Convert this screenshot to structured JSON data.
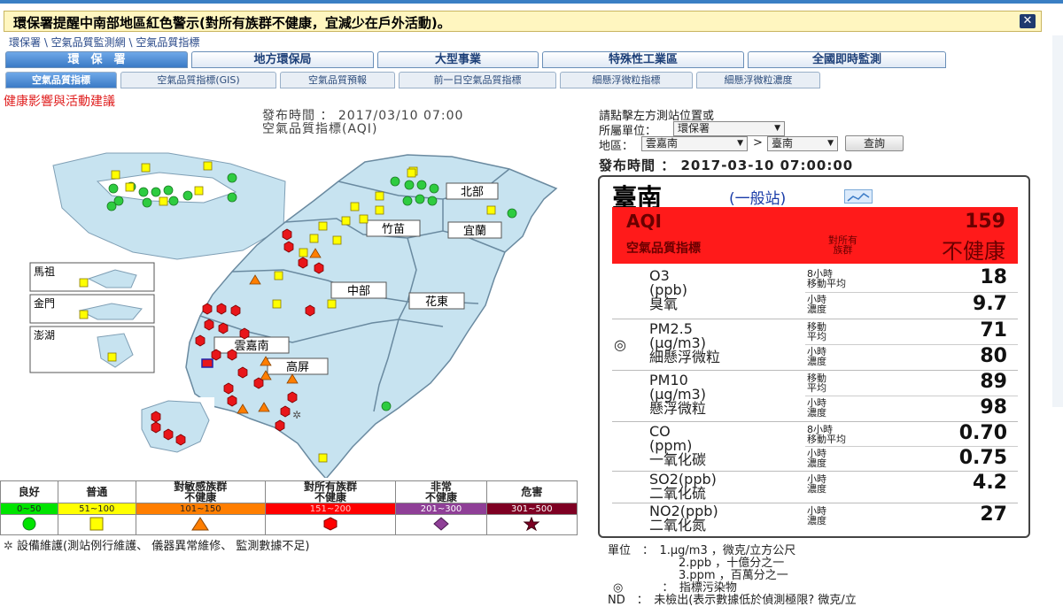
{
  "warning": {
    "text": "環保署提醒中南部地區紅色警示(對所有族群不健康，宜減少在戶外活動)。",
    "close_icon": "close-icon"
  },
  "breadcrumb": "環保署 \\ 空氣品質監測網 \\ 空氣品質指標",
  "main_tabs": [
    "環　保　署",
    "地方環保局",
    "大型事業",
    "特殊性工業區",
    "全國即時監測"
  ],
  "sub_tabs": [
    "空氣品質指標",
    "空氣品質指標(GIS)",
    "空氣品質預報",
    "前一日空氣品質指標",
    "細懸浮微粒指標",
    "細懸浮微粒濃度"
  ],
  "health_link": "健康影響與活動建議",
  "map": {
    "publish_time": "發布時間 ： 2017/03/10 07:00",
    "title": "空氣品質指標(AQI)",
    "regions": [
      "北部",
      "竹苗",
      "宜蘭",
      "中部",
      "花東",
      "雲嘉南",
      "高屏"
    ],
    "islands": [
      "馬祖",
      "金門",
      "澎湖"
    ]
  },
  "legend": {
    "headers": [
      "良好",
      "普通",
      "對敏感族群\n不健康",
      "對所有族群\n不健康",
      "非常\n不健康",
      "危害"
    ],
    "ranges": [
      "0~50",
      "51~100",
      "101~150",
      "151~200",
      "201~300",
      "301~500"
    ],
    "colors": [
      "#00e400",
      "#ffff00",
      "#ff7e00",
      "#ff0000",
      "#8f3f97",
      "#7e0023"
    ],
    "symbols": [
      "circle",
      "square",
      "triangle",
      "hexagon",
      "diamond",
      "star"
    ],
    "maintenance": "設備維護(測站例行維護、 儀器異常維修、 監測數據不足)"
  },
  "query": {
    "hint": "請點擊左方測站位置或",
    "unit_label": "所屬單位：",
    "unit_value": "環保署",
    "area_label": "地區：",
    "area_value": "雲嘉南",
    "city_value": "臺南",
    "search_button": "查詢"
  },
  "station": {
    "publish_time": "發布時間 ： 2017-03-10 07:00:00",
    "name": "臺南",
    "type": "(一般站)",
    "aqi_label": "AQI",
    "aqi_value": "159",
    "aqi_sub": "空氣品質指標",
    "group": "對所有\n族群",
    "status": "不健康",
    "pollutants": [
      {
        "name": "O3",
        "unit": "(ppb)",
        "cn": "臭氧",
        "primary": false,
        "m1_label": "8小時\n移動平均",
        "m1_value": "18",
        "m2_label": "小時\n濃度",
        "m2_value": "9.7"
      },
      {
        "name": "PM2.5",
        "unit": "(μg/m3)",
        "cn": "細懸浮微粒",
        "primary": true,
        "m1_label": "移動\n平均",
        "m1_value": "71",
        "m2_label": "小時\n濃度",
        "m2_value": "80"
      },
      {
        "name": "PM10",
        "unit": "(μg/m3)",
        "cn": "懸浮微粒",
        "primary": false,
        "m1_label": "移動\n平均",
        "m1_value": "89",
        "m2_label": "小時\n濃度",
        "m2_value": "98"
      },
      {
        "name": "CO",
        "unit": "(ppm)",
        "cn": "一氧化碳",
        "primary": false,
        "m1_label": "8小時\n移動平均",
        "m1_value": "0.70",
        "m2_label": "小時\n濃度",
        "m2_value": "0.75"
      },
      {
        "name": "SO2(ppb)",
        "unit": "",
        "cn": "二氧化硫",
        "primary": false,
        "m1_label": "小時\n濃度",
        "m1_value": "4.2",
        "m2_label": "",
        "m2_value": ""
      },
      {
        "name": "NO2(ppb)",
        "unit": "",
        "cn": "二氧化氮",
        "primary": false,
        "m1_label": "小時\n濃度",
        "m1_value": "27",
        "m2_label": "",
        "m2_value": ""
      }
    ]
  },
  "notes": {
    "unit_line1": "單位　：　1.μg/m3 ，微克/立方公尺",
    "unit_line2": "2.ppb ，十億分之一",
    "unit_line3": "3.ppm ，百萬分之一",
    "index_line": "：　指標污染物",
    "nd_line": "ND　：　未檢出(表示數據低於偵測極限? 微克/立"
  }
}
